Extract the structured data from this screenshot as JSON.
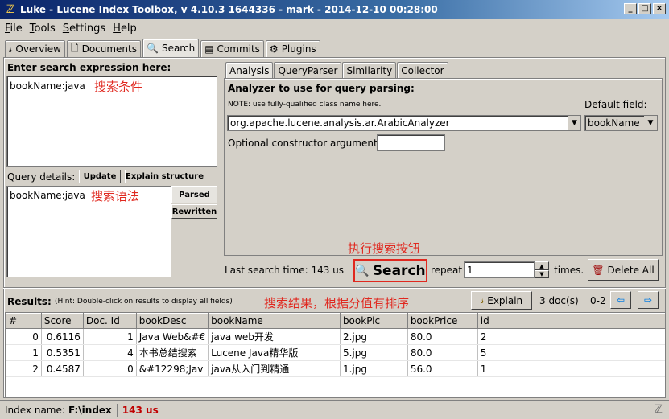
{
  "window": {
    "title": "Luke - Lucene Index Toolbox, v 4.10.3 1644336 - mark - 2014-12-10 00:28:00"
  },
  "menu": [
    "File",
    "Tools",
    "Settings",
    "Help"
  ],
  "main_tabs": [
    {
      "label": "Overview",
      "icon": "overview-icon"
    },
    {
      "label": "Documents",
      "icon": "documents-icon"
    },
    {
      "label": "Search",
      "icon": "search-icon"
    },
    {
      "label": "Commits",
      "icon": "commits-icon"
    },
    {
      "label": "Plugins",
      "icon": "plugins-icon"
    }
  ],
  "search": {
    "expression_label": "Enter search expression here:",
    "expression_value": "bookName:java",
    "expression_annotation": "搜索条件",
    "query_details_label": "Query details:",
    "update_button": "Update",
    "explain_structure_button": "Explain structure",
    "parsed_value": "bookName:java",
    "parsed_annotation": "搜索语法",
    "parsed_tab": "Parsed",
    "rewritten_tab": "Rewritten"
  },
  "analysis": {
    "tabs": [
      "Analysis",
      "QueryParser",
      "Similarity",
      "Collector"
    ],
    "analyzer_heading": "Analyzer to use for query parsing:",
    "note": "NOTE: use fully-qualified class name here.",
    "default_field_label": "Default field:",
    "analyzer_value": "org.apache.lucene.analysis.ar.ArabicAnalyzer",
    "default_field_value": "bookName",
    "constructor_label": "Optional constructor argument:",
    "constructor_value": ""
  },
  "search_bar": {
    "annotation": "执行搜索按钮",
    "last_search_label": "Last search time: 143 us",
    "search_button": "Search",
    "repeat_label": "repeat",
    "repeat_value": "1",
    "times_label": "times.",
    "delete_all_button": "Delete All"
  },
  "results": {
    "label": "Results:",
    "hint": "(Hint: Double-click on results to display all fields)",
    "annotation": "搜索结果，根据分值有排序",
    "explain_button": "Explain",
    "doc_count": "3 doc(s)",
    "range": "0-2",
    "columns": [
      "#",
      "Score",
      "Doc. Id",
      "bookDesc",
      "bookName",
      "bookPic",
      "bookPrice",
      "id"
    ],
    "rows": [
      [
        "0",
        "0.6116",
        "1",
        "Java Web&#€",
        "java web开发",
        "2.jpg",
        "80.0",
        "2"
      ],
      [
        "1",
        "0.5351",
        "4",
        "本书总结搜索",
        "Lucene Java精华版",
        "5.jpg",
        "80.0",
        "5"
      ],
      [
        "2",
        "0.4587",
        "0",
        "&#12298;Jav",
        "java从入门到精通",
        "1.jpg",
        "56.0",
        "1"
      ]
    ]
  },
  "status": {
    "index_label": "Index name:",
    "index_value": "F:\\index",
    "time_value": "143 us"
  },
  "colors": {
    "title_bar": "#0a246a",
    "annotation_red": "#e0281f",
    "highlight_border": "#e0281f"
  }
}
